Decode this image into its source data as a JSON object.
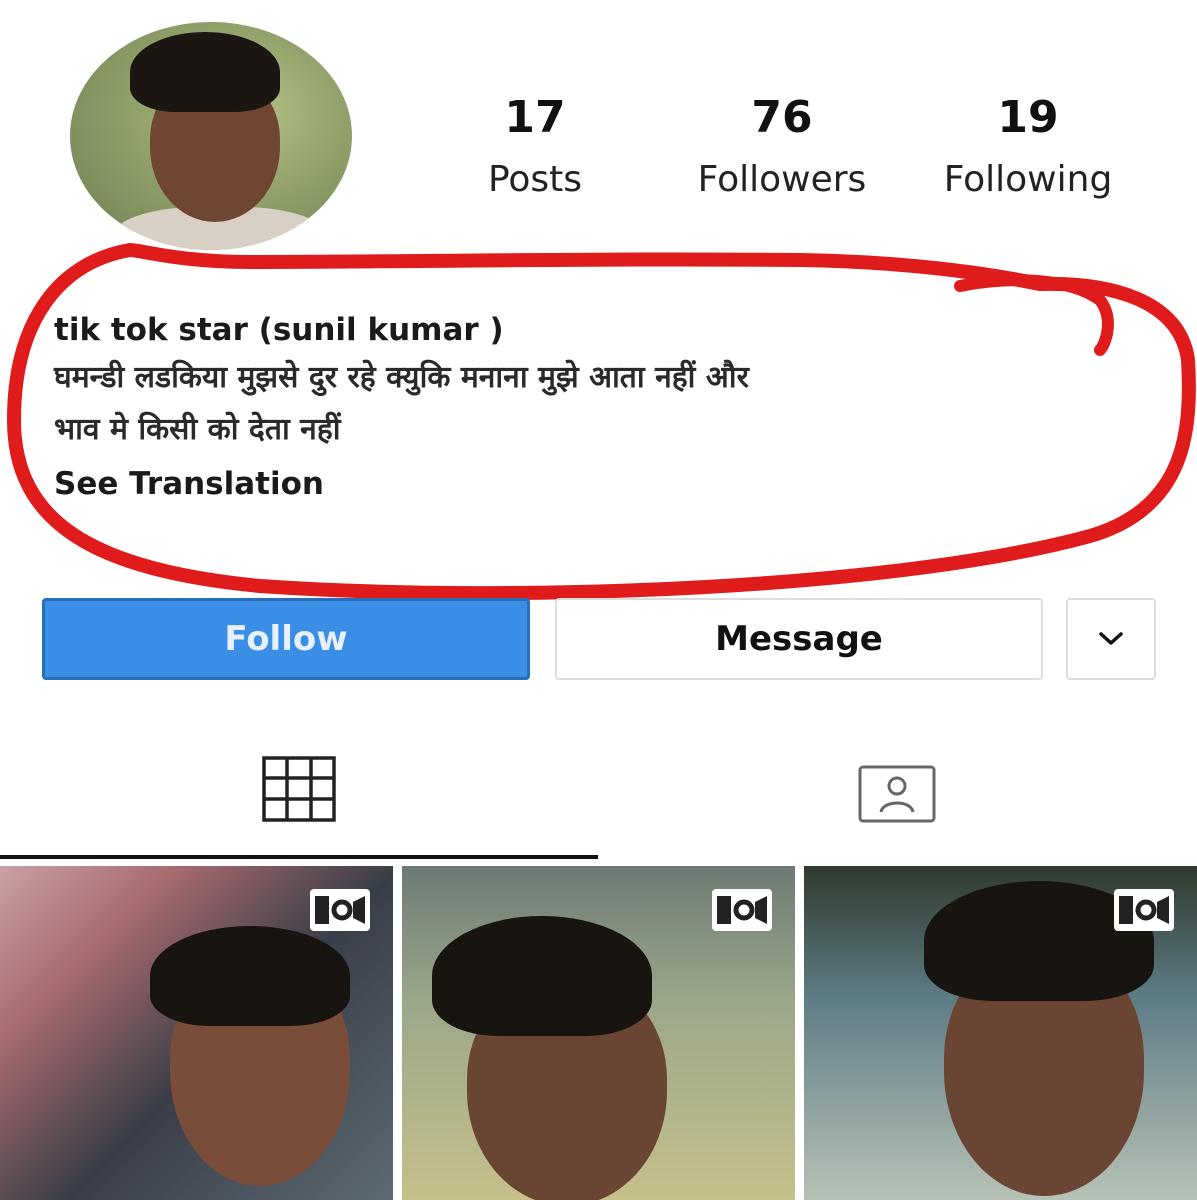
{
  "profile": {
    "stats": {
      "posts": {
        "count": "17",
        "label": "Posts"
      },
      "followers": {
        "count": "76",
        "label": "Followers"
      },
      "following": {
        "count": "19",
        "label": "Following"
      }
    },
    "bio": {
      "name_line": "tik tok star (sunil kumar )",
      "line1": "घमन्डी लडकिया मुझसे दुर रहे क्युकि मनाना मुझे आता नहीं और",
      "line2": "भाव मे किसी को देता नहीं",
      "see_translation": "See Translation"
    }
  },
  "actions": {
    "follow_label": "Follow",
    "message_label": "Message",
    "more_icon": "chevron-down-icon"
  },
  "tabs": {
    "grid_icon": "grid-icon",
    "tagged_icon": "tagged-person-icon"
  },
  "posts": [
    {
      "type": "reel",
      "icon": "reel-camera-icon"
    },
    {
      "type": "reel",
      "icon": "reel-camera-icon"
    },
    {
      "type": "reel",
      "icon": "reel-camera-icon"
    }
  ],
  "colors": {
    "follow_button": "#3a8ee6",
    "annotation_circle": "#e01b1b"
  }
}
